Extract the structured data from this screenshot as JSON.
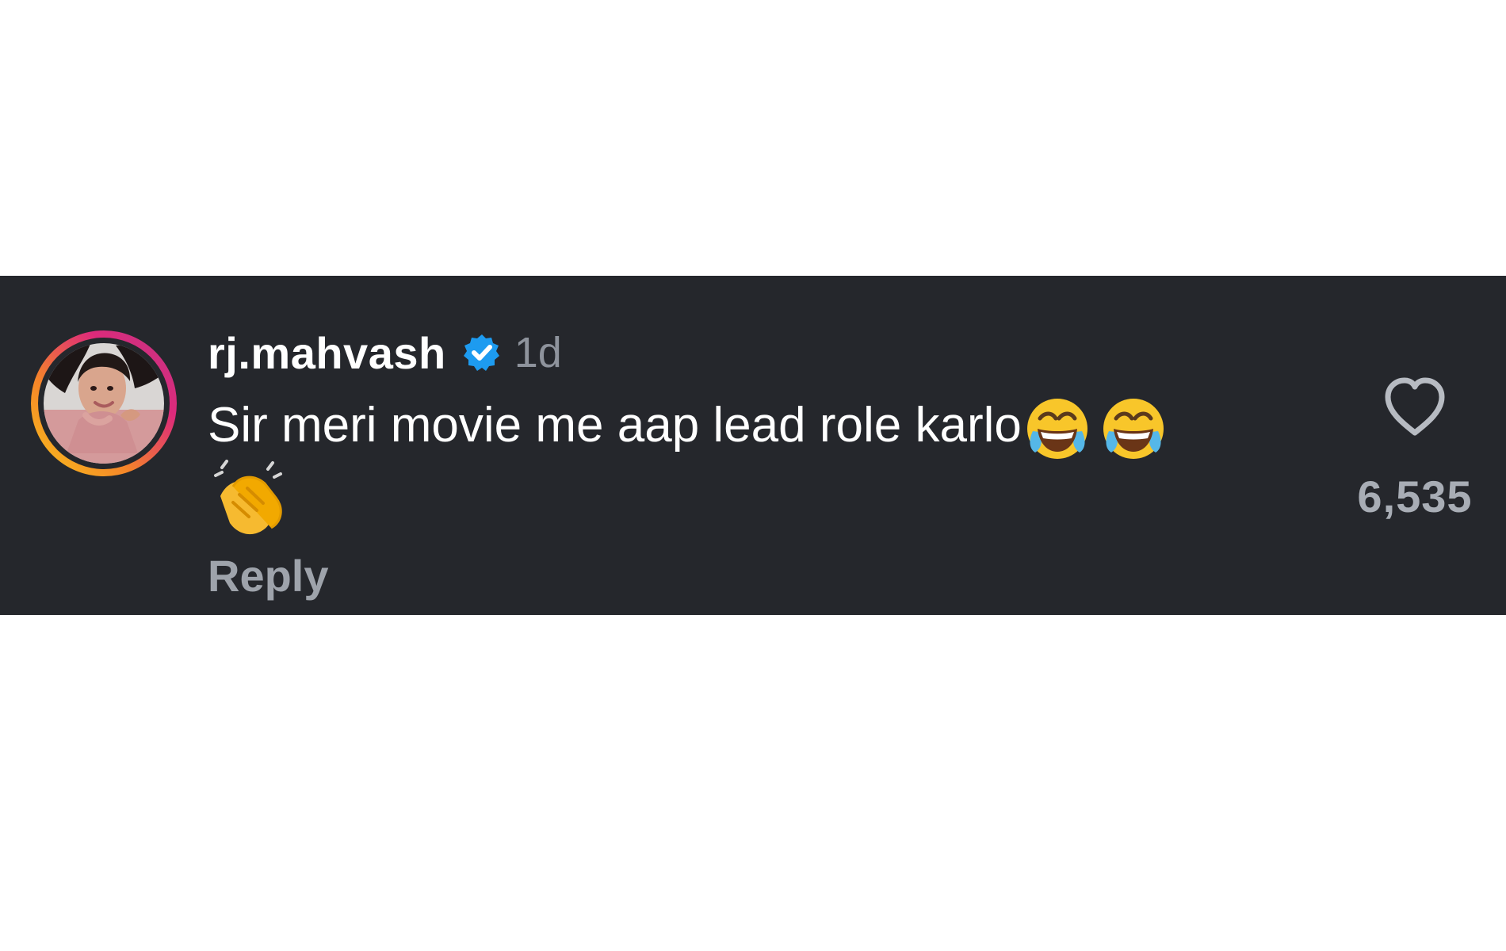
{
  "comment": {
    "username": "rj.mahvash",
    "timestamp": "1d",
    "text": "Sir meri movie me aap lead role karlo",
    "reply_label": "Reply",
    "like_count": "6,535",
    "icons": {
      "verified": "verified-badge-icon",
      "like": "heart-icon",
      "emoji_1": "face-with-tears-of-joy-icon",
      "emoji_2": "face-with-tears-of-joy-icon",
      "emoji_3": "clapping-hands-icon"
    }
  },
  "colors": {
    "panel_background": "#25272c",
    "username": "#ffffff",
    "muted_text": "#8e939c",
    "verified_blue": "#1d9bf0"
  }
}
